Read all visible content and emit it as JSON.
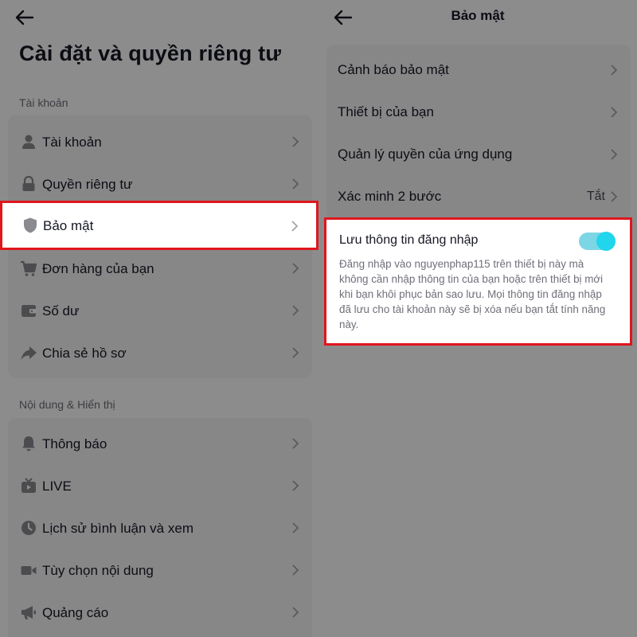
{
  "left": {
    "title": "Cài đặt và quyền riêng tư",
    "sections": [
      {
        "label": "Tài khoản",
        "items": [
          {
            "label": "Tài khoản",
            "icon": "person-icon"
          },
          {
            "label": "Quyền riêng tư",
            "icon": "lock-icon"
          },
          {
            "label": "Bảo mật",
            "icon": "shield-icon",
            "highlighted": true
          },
          {
            "label": "Đơn hàng của bạn",
            "icon": "cart-icon"
          },
          {
            "label": "Số dư",
            "icon": "wallet-icon"
          },
          {
            "label": "Chia sẻ hồ sơ",
            "icon": "share-icon"
          }
        ]
      },
      {
        "label": "Nội dung & Hiển thị",
        "items": [
          {
            "label": "Thông báo",
            "icon": "bell-icon"
          },
          {
            "label": "LIVE",
            "icon": "live-tv-icon"
          },
          {
            "label": "Lịch sử bình luận và xem",
            "icon": "history-clock-icon"
          },
          {
            "label": "Tùy chọn nội dung",
            "icon": "video-camera-icon"
          },
          {
            "label": "Quảng cáo",
            "icon": "megaphone-icon"
          }
        ]
      }
    ]
  },
  "right": {
    "title": "Bảo mật",
    "items": [
      {
        "label": "Cảnh báo bảo mật"
      },
      {
        "label": "Thiết bị của bạn"
      },
      {
        "label": "Quản lý quyền của ứng dụng"
      },
      {
        "label": "Xác minh 2 bước",
        "status": "Tắt"
      }
    ],
    "save_login": {
      "title": "Lưu thông tin đăng nhập",
      "enabled": true,
      "description": "Đăng nhập vào nguyenphap115 trên thiết bị này mà không cần nhập thông tin của bạn hoặc trên thiết bị mới khi bạn khôi phục bản sao lưu. Mọi thông tin đăng nhập đã lưu cho tài khoản này sẽ bị xóa nếu bạn tắt tính năng này."
    }
  },
  "colors": {
    "highlight_border": "#e0161d",
    "toggle_on": "#20d5ec",
    "toggle_track": "#7dd6e5"
  }
}
